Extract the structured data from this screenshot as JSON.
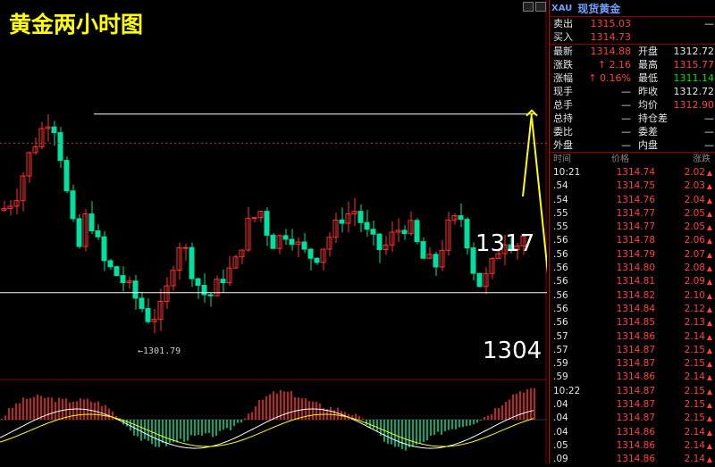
{
  "title": "黄金两小时图",
  "levels": {
    "high": "1317",
    "low": "1304",
    "low_point": "1301.79"
  },
  "chart_data": {
    "type": "candlestick",
    "title": "黄金两小时图",
    "resistance": 1317,
    "support": 1304,
    "low_marker": 1301.79,
    "ylim": [
      1298,
      1324
    ],
    "colors": {
      "up": "#ff3030",
      "down": "#00e0a0",
      "level": "#ffffff",
      "arrow": "#ffff00",
      "ma": "#ffff00"
    }
  },
  "panel": {
    "code": "XAU",
    "name": "现货黄金",
    "quote_rows": [
      {
        "l1": "卖出",
        "v1": "1315.03",
        "c1": "red",
        "l2": "",
        "v2": "—",
        "c2": "white"
      },
      {
        "l1": "买入",
        "v1": "1314.73",
        "c1": "red",
        "l2": "",
        "v2": "",
        "c2": "white"
      }
    ],
    "stat_rows": [
      {
        "l1": "最新",
        "v1": "1314.88",
        "c1": "red",
        "l2": "开盘",
        "v2": "1312.72",
        "c2": "white"
      },
      {
        "l1": "涨跌",
        "v1": "↑ 2.16",
        "c1": "red",
        "l2": "最高",
        "v2": "1315.77",
        "c2": "red"
      },
      {
        "l1": "涨幅",
        "v1": "↑ 0.16%",
        "c1": "red",
        "l2": "最低",
        "v2": "1311.14",
        "c2": "green"
      },
      {
        "l1": "现手",
        "v1": "—",
        "c1": "white",
        "l2": "昨收",
        "v2": "1312.72",
        "c2": "white"
      },
      {
        "l1": "总手",
        "v1": "—",
        "c1": "white",
        "l2": "均价",
        "v2": "1312.90",
        "c2": "red"
      },
      {
        "l1": "总持",
        "v1": "—",
        "c1": "white",
        "l2": "持仓差",
        "v2": "—",
        "c2": "white"
      },
      {
        "l1": "委比",
        "v1": "—",
        "c1": "white",
        "l2": "委差",
        "v2": "—",
        "c2": "white"
      },
      {
        "l1": "外盘",
        "v1": "—",
        "c1": "white",
        "l2": "内盘",
        "v2": "—",
        "c2": "white"
      }
    ],
    "tick_header": [
      "时间",
      "价格",
      "涨跌"
    ],
    "ticks": [
      {
        "t": "10:21",
        "p": "1314.74",
        "c": "2.02"
      },
      {
        "t": ".54",
        "p": "1314.75",
        "c": "2.03"
      },
      {
        "t": ".54",
        "p": "1314.76",
        "c": "2.04"
      },
      {
        "t": ".55",
        "p": "1314.77",
        "c": "2.05"
      },
      {
        "t": ".55",
        "p": "1314.77",
        "c": "2.05"
      },
      {
        "t": ".56",
        "p": "1314.78",
        "c": "2.06"
      },
      {
        "t": ".56",
        "p": "1314.79",
        "c": "2.07"
      },
      {
        "t": ".56",
        "p": "1314.80",
        "c": "2.08"
      },
      {
        "t": ".56",
        "p": "1314.81",
        "c": "2.09"
      },
      {
        "t": ".56",
        "p": "1314.82",
        "c": "2.10"
      },
      {
        "t": ".56",
        "p": "1314.84",
        "c": "2.12"
      },
      {
        "t": ".56",
        "p": "1314.85",
        "c": "2.13"
      },
      {
        "t": ".57",
        "p": "1314.86",
        "c": "2.14"
      },
      {
        "t": ".57",
        "p": "1314.87",
        "c": "2.15"
      },
      {
        "t": ".59",
        "p": "1314.87",
        "c": "2.15"
      },
      {
        "t": ".59",
        "p": "1314.86",
        "c": "2.14"
      },
      {
        "t": "10:22",
        "p": "1314.87",
        "c": "2.15"
      },
      {
        "t": ".04",
        "p": "1314.87",
        "c": "2.15"
      },
      {
        "t": ".04",
        "p": "1314.87",
        "c": "2.15"
      },
      {
        "t": ".04",
        "p": "1314.86",
        "c": "2.14"
      },
      {
        "t": ".05",
        "p": "1314.86",
        "c": "2.14"
      },
      {
        "t": ".09",
        "p": "1314.86",
        "c": "2.14"
      }
    ]
  }
}
